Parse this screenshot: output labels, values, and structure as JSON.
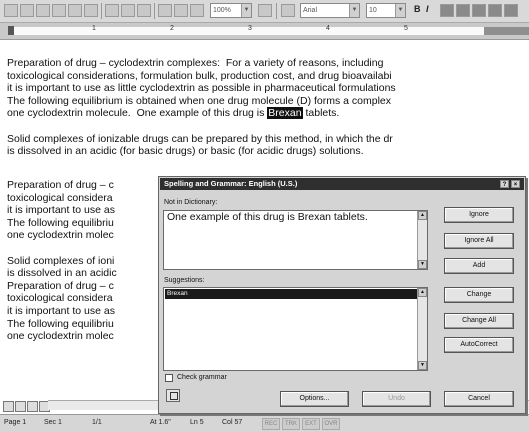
{
  "toolbar": {
    "zoom": "100%",
    "font": "Arial",
    "size": "10",
    "bold": "B",
    "italic": "I"
  },
  "ruler": {
    "numbers": [
      "1",
      "2",
      "3",
      "4",
      "5"
    ]
  },
  "document": {
    "lines": [
      "Preparation of drug – cyclodextrin complexes:  For a variety of reasons, including",
      "toxicological considerations, formulation bulk, production cost, and drug bioavailabi",
      "it is important to use as little cyclodextrin as possible in pharmaceutical formulations",
      "The following equilibrium is obtained when one drug molecule (D) forms a complex",
      "one cyclodextrin molecule.  One example of this drug is ",
      "Brexan",
      " tablets.",
      "Solid complexes of ionizable drugs can be prepared by this method, in which the dr",
      "is dissolved in an acidic (for basic drugs) or basic (for acidic drugs) solutions.",
      "Preparation of drug – c",
      "toxicological considera",
      "it is important to use as",
      "The following equilibriu",
      "one cyclodextrin molec",
      "Solid complexes of ioni",
      "is dissolved in an acidic",
      "Preparation of drug – c",
      "toxicological considera",
      "it is important to use as",
      "The following equilibriu",
      "one cyclodextrin molec"
    ]
  },
  "statusbar": {
    "page": "Page 1",
    "section": "Sec 1",
    "pages": "1/1",
    "at": "At 1.6\"",
    "line": "Ln 5",
    "col": "Col 57",
    "modes": [
      "REC",
      "TRK",
      "EXT",
      "OVR"
    ]
  },
  "dialog": {
    "title": "Spelling and Grammar: English (U.S.)",
    "not_in_dict_label": "Not in Dictionary:",
    "sentence_before": "One example of this drug is ",
    "flagged_word": "Brexan",
    "sentence_after": " tablets.",
    "suggestions_label": "Suggestions:",
    "suggestions": [
      "Brexan"
    ],
    "check_grammar_label": "Check grammar",
    "buttons": {
      "ignore": "Ignore",
      "ignore_all": "Ignore All",
      "add": "Add",
      "change": "Change",
      "change_all": "Change All",
      "autocorrect": "AutoCorrect",
      "options": "Options...",
      "undo": "Undo",
      "cancel": "Cancel"
    }
  }
}
